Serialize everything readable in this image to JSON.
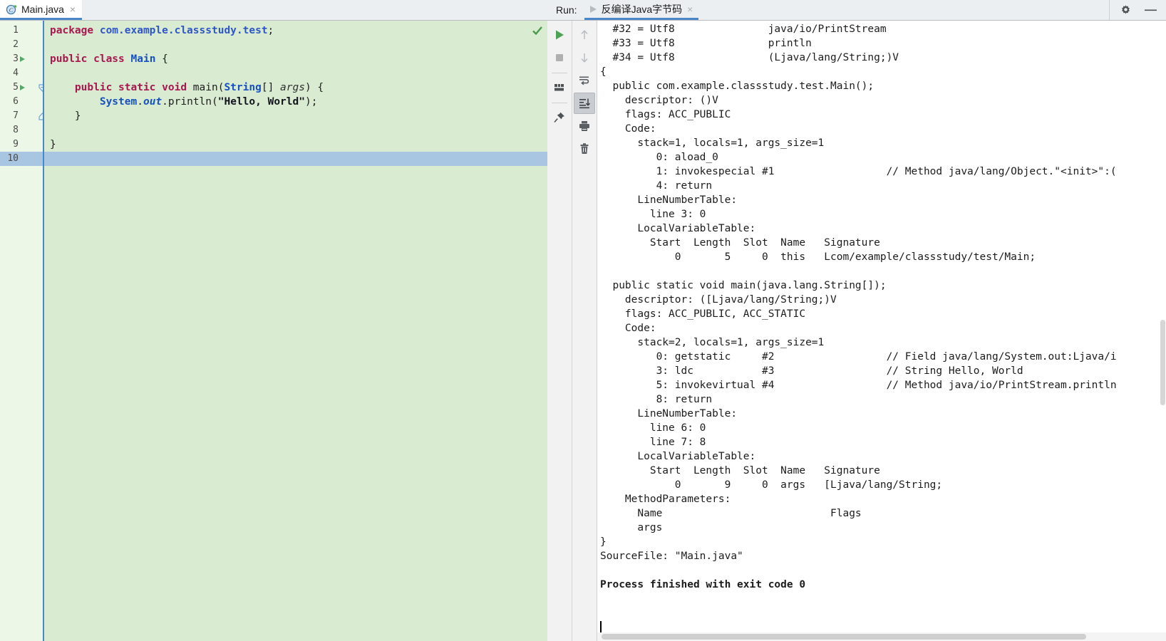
{
  "window": {
    "gear_icon": "gear-icon",
    "minimize_icon": "minimize-icon"
  },
  "editor": {
    "tab": {
      "label": "Main.java",
      "icon": "java-class-icon",
      "close": "×"
    },
    "status_icon": "inspection-ok-check",
    "current_line": 10,
    "gutter_lines": [
      {
        "num": "1",
        "run": false,
        "fold": ""
      },
      {
        "num": "2",
        "run": false,
        "fold": ""
      },
      {
        "num": "3",
        "run": true,
        "fold": ""
      },
      {
        "num": "4",
        "run": false,
        "fold": ""
      },
      {
        "num": "5",
        "run": true,
        "fold": "collapse"
      },
      {
        "num": "6",
        "run": false,
        "fold": ""
      },
      {
        "num": "7",
        "run": false,
        "fold": "end"
      },
      {
        "num": "8",
        "run": false,
        "fold": ""
      },
      {
        "num": "9",
        "run": false,
        "fold": ""
      },
      {
        "num": "10",
        "run": false,
        "fold": ""
      }
    ],
    "code_lines": [
      [
        {
          "t": "package ",
          "c": "kw"
        },
        {
          "t": "com.example.classstudy.test",
          "c": "pkg"
        },
        {
          "t": ";",
          "c": "pln"
        }
      ],
      [],
      [
        {
          "t": "public class ",
          "c": "kw"
        },
        {
          "t": "Main",
          "c": "typ"
        },
        {
          "t": " {",
          "c": "pln"
        }
      ],
      [],
      [
        {
          "t": "    public static void ",
          "c": "kw"
        },
        {
          "t": "main",
          "c": "pln"
        },
        {
          "t": "(",
          "c": "pln"
        },
        {
          "t": "String",
          "c": "typ"
        },
        {
          "t": "[] ",
          "c": "pln"
        },
        {
          "t": "args",
          "c": "fld2"
        },
        {
          "t": ") {",
          "c": "pln"
        }
      ],
      [
        {
          "t": "        ",
          "c": "pln"
        },
        {
          "t": "System",
          "c": "typ"
        },
        {
          "t": ".",
          "c": "pln"
        },
        {
          "t": "out",
          "c": "fld"
        },
        {
          "t": ".println(",
          "c": "pln"
        },
        {
          "t": "\"Hello, World\"",
          "c": "str"
        },
        {
          "t": ");",
          "c": "pln"
        }
      ],
      [
        {
          "t": "    }",
          "c": "pln"
        }
      ],
      [],
      [
        {
          "t": "}",
          "c": "pln"
        }
      ],
      []
    ]
  },
  "run_panel": {
    "label": "Run:",
    "tab_label": "反编译Java字节码",
    "tab_close": "×",
    "toolbar_left": [
      {
        "name": "rerun-button",
        "icon": "play-icon"
      },
      {
        "name": "stop-button",
        "icon": "stop-square-icon"
      },
      {
        "name": "separator",
        "icon": "separator"
      },
      {
        "name": "show-running-list-button",
        "icon": "running-list-icon"
      },
      {
        "name": "separator",
        "icon": "separator"
      },
      {
        "name": "pin-tab-button",
        "icon": "pin-icon"
      }
    ],
    "toolbar_right": [
      {
        "name": "up-the-stack-trace-button",
        "icon": "arrow-up-icon",
        "active": false
      },
      {
        "name": "down-the-stack-trace-button",
        "icon": "arrow-down-icon",
        "active": false
      },
      {
        "name": "soft-wrap-button",
        "icon": "soft-wrap-icon",
        "active": false
      },
      {
        "name": "scroll-to-end-button",
        "icon": "scroll-to-end-icon",
        "active": true
      },
      {
        "name": "print-button",
        "icon": "printer-icon",
        "active": false
      },
      {
        "name": "clear-all-button",
        "icon": "trash-icon",
        "active": false
      }
    ],
    "console_lines": [
      {
        "text": "  #32 = Utf8               java/io/PrintStream",
        "bold": false
      },
      {
        "text": "  #33 = Utf8               println",
        "bold": false
      },
      {
        "text": "  #34 = Utf8               (Ljava/lang/String;)V",
        "bold": false
      },
      {
        "text": "{",
        "bold": false
      },
      {
        "text": "  public com.example.classstudy.test.Main();",
        "bold": false
      },
      {
        "text": "    descriptor: ()V",
        "bold": false
      },
      {
        "text": "    flags: ACC_PUBLIC",
        "bold": false
      },
      {
        "text": "    Code:",
        "bold": false
      },
      {
        "text": "      stack=1, locals=1, args_size=1",
        "bold": false
      },
      {
        "text": "         0: aload_0",
        "bold": false
      },
      {
        "text": "         1: invokespecial #1                  // Method java/lang/Object.\"<init>\":(",
        "bold": false
      },
      {
        "text": "         4: return",
        "bold": false
      },
      {
        "text": "      LineNumberTable:",
        "bold": false
      },
      {
        "text": "        line 3: 0",
        "bold": false
      },
      {
        "text": "      LocalVariableTable:",
        "bold": false
      },
      {
        "text": "        Start  Length  Slot  Name   Signature",
        "bold": false
      },
      {
        "text": "            0       5     0  this   Lcom/example/classstudy/test/Main;",
        "bold": false
      },
      {
        "text": "",
        "bold": false
      },
      {
        "text": "  public static void main(java.lang.String[]);",
        "bold": false
      },
      {
        "text": "    descriptor: ([Ljava/lang/String;)V",
        "bold": false
      },
      {
        "text": "    flags: ACC_PUBLIC, ACC_STATIC",
        "bold": false
      },
      {
        "text": "    Code:",
        "bold": false
      },
      {
        "text": "      stack=2, locals=1, args_size=1",
        "bold": false
      },
      {
        "text": "         0: getstatic     #2                  // Field java/lang/System.out:Ljava/i",
        "bold": false
      },
      {
        "text": "         3: ldc           #3                  // String Hello, World",
        "bold": false
      },
      {
        "text": "         5: invokevirtual #4                  // Method java/io/PrintStream.println",
        "bold": false
      },
      {
        "text": "         8: return",
        "bold": false
      },
      {
        "text": "      LineNumberTable:",
        "bold": false
      },
      {
        "text": "        line 6: 0",
        "bold": false
      },
      {
        "text": "        line 7: 8",
        "bold": false
      },
      {
        "text": "      LocalVariableTable:",
        "bold": false
      },
      {
        "text": "        Start  Length  Slot  Name   Signature",
        "bold": false
      },
      {
        "text": "            0       9     0  args   [Ljava/lang/String;",
        "bold": false
      },
      {
        "text": "    MethodParameters:",
        "bold": false
      },
      {
        "text": "      Name                           Flags",
        "bold": false
      },
      {
        "text": "      args",
        "bold": false
      },
      {
        "text": "}",
        "bold": false
      },
      {
        "text": "SourceFile: \"Main.java\"",
        "bold": false
      },
      {
        "text": "",
        "bold": false
      },
      {
        "text": "Process finished with exit code 0",
        "bold": true
      }
    ]
  }
}
